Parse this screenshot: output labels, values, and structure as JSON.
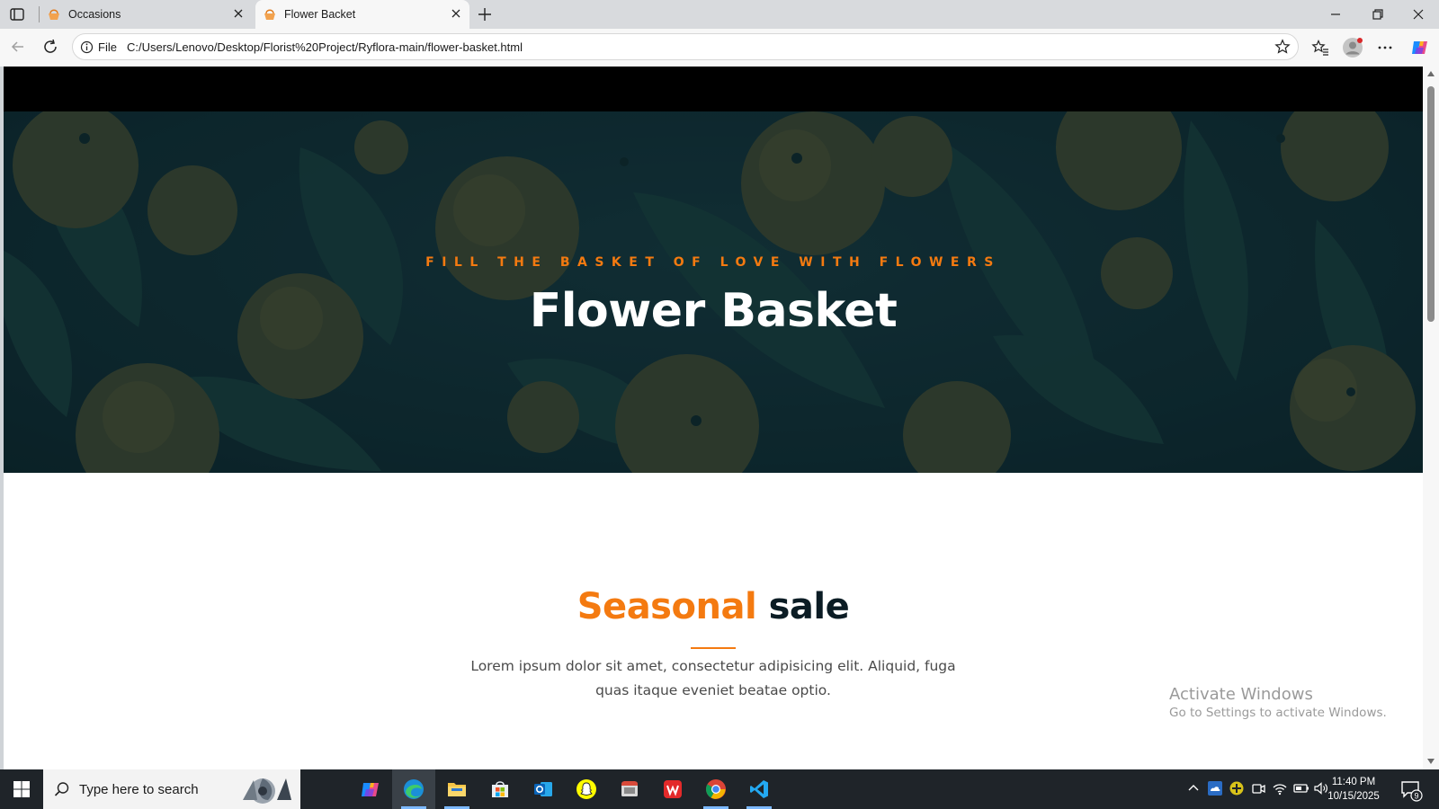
{
  "browser": {
    "tabs": [
      {
        "title": "Occasions",
        "active": false
      },
      {
        "title": "Flower Backet",
        "active": true
      }
    ],
    "address": {
      "scheme_label": "File",
      "url": "C:/Users/Lenovo/Desktop/Florist%20Project/Ryflora-main/flower-basket.html"
    },
    "icons": [
      "tab-actions-icon",
      "new-tab-icon",
      "minimize-icon",
      "restore-icon",
      "close-window-icon",
      "back-icon",
      "reload-icon",
      "info-icon",
      "favorite-star-icon",
      "favorites-icon",
      "profile-icon",
      "more-icon",
      "copilot-icon"
    ]
  },
  "page": {
    "hero": {
      "kicker": "FILL THE BASKET OF LOVE WITH FLOWERS",
      "title": "Flower Basket"
    },
    "section": {
      "title_accent": "Seasonal",
      "title_rest": "sale",
      "description": "Lorem ipsum dolor sit amet, consectetur adipisicing elit. Aliquid, fuga quas itaque eveniet beatae optio."
    },
    "colors": {
      "accent": "#f47a10",
      "dark": "#0b1c24",
      "hero_overlay": "#10272d"
    }
  },
  "watermark": {
    "title": "Activate Windows",
    "subtitle": "Go to Settings to activate Windows."
  },
  "taskbar": {
    "search_placeholder": "Type here to search",
    "apps": [
      "copilot",
      "edge",
      "file-explorer",
      "microsoft-store",
      "outlook",
      "snapchat",
      "photos",
      "wps-office",
      "chrome",
      "vscode"
    ],
    "clock": {
      "time": "11:40 PM",
      "date": "10/15/2025"
    },
    "notification_count": "9"
  }
}
